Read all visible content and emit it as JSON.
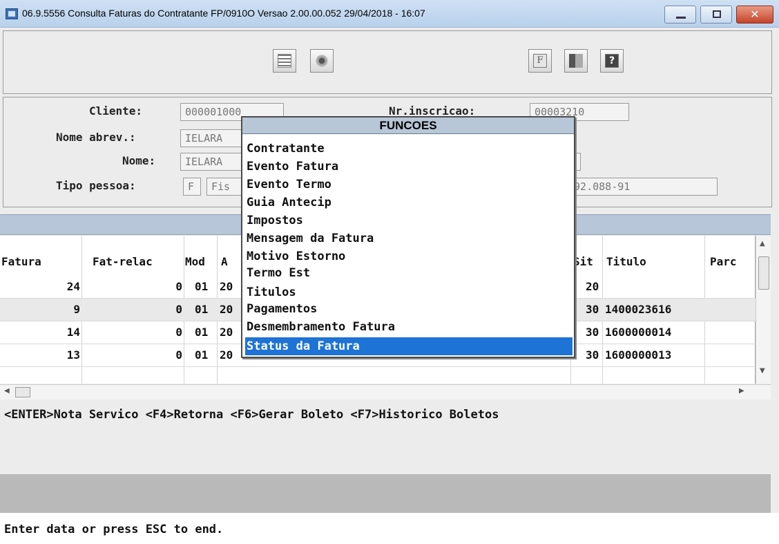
{
  "window": {
    "title": "06.9.5556 Consulta Faturas do Contratante FP/0910O Versao 2.00.00.052 29/04/2018 - 16:07",
    "minimize_glyph": "",
    "maximize_glyph": "",
    "close_glyph": "✕"
  },
  "toolbar": {
    "icons": [
      "list-icon",
      "gear-icon",
      "f-icon",
      "exit-icon",
      "help-icon"
    ],
    "f_text": "F",
    "help_text": "?"
  },
  "form": {
    "cliente_label": "Cliente:",
    "cliente_value": "000001000",
    "nr_inscricao_label": "Nr.inscricao:",
    "nr_inscricao_value": "00003210",
    "nome_abrev_label": "Nome abrev.:",
    "nome_abrev_value": "IELARA",
    "nome_label": "Nome:",
    "nome_value": "IELARA",
    "tipo_pessoa_label": "Tipo pessoa:",
    "tipo_pessoa_code": "F",
    "tipo_pessoa_value": "Fis",
    "cpf_value": "892.088-91"
  },
  "grid": {
    "columns": {
      "fatura": "Fatura",
      "fat_relac": "Fat-relac",
      "mod": "Mod",
      "a": "A",
      "sit": "Sit",
      "titulo": "Titulo",
      "parc": "Parc"
    },
    "rows": [
      {
        "fatura": "24",
        "fat_relac": "0",
        "mod": "01",
        "a": "20",
        "sit": "20",
        "titulo": ""
      },
      {
        "fatura": "9",
        "fat_relac": "0",
        "mod": "01",
        "a": "20",
        "sit": "30",
        "titulo": "1400023616"
      },
      {
        "fatura": "14",
        "fat_relac": "0",
        "mod": "01",
        "a": "20",
        "sit": "30",
        "titulo": "1600000014"
      },
      {
        "fatura": "13",
        "fat_relac": "0",
        "mod": "01",
        "a": "20",
        "sit": "30",
        "titulo": "1600000013"
      }
    ]
  },
  "hotkeys": "<ENTER>Nota Servico <F4>Retorna <F6>Gerar Boleto <F7>Historico Boletos",
  "status": "Enter data or press ESC to end.",
  "menu": {
    "title": "FUNCOES",
    "items": [
      "Contratante",
      "Evento Fatura",
      "Evento Termo",
      "Guia Antecip",
      "Impostos",
      "Mensagem da Fatura",
      "Motivo Estorno",
      "Termo Est",
      "Titulos",
      "Pagamentos",
      "Desmembramento Fatura",
      "Status da Fatura"
    ],
    "selected_index": 11
  },
  "colors": {
    "menu_highlight": "#1e73d6",
    "header_strip": "#b7c6d9"
  }
}
